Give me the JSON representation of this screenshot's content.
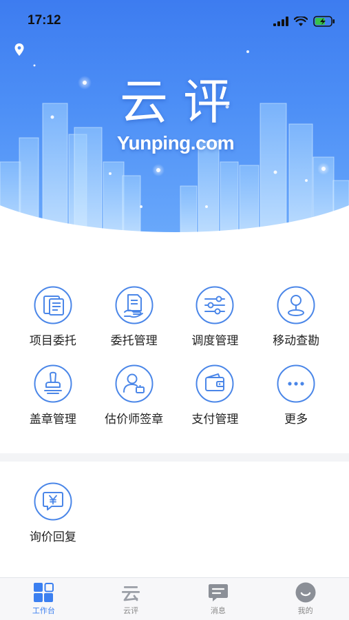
{
  "status_bar": {
    "time": "17:12"
  },
  "hero": {
    "logo_cn": "云评",
    "logo_en": "Yunping.com"
  },
  "grid": {
    "items": [
      {
        "label": "项目委托",
        "icon": "document-list-icon"
      },
      {
        "label": "委托管理",
        "icon": "document-hand-icon"
      },
      {
        "label": "调度管理",
        "icon": "sliders-icon"
      },
      {
        "label": "移动查勘",
        "icon": "map-pin-icon"
      },
      {
        "label": "盖章管理",
        "icon": "stamp-icon"
      },
      {
        "label": "估价师签章",
        "icon": "user-stamp-icon"
      },
      {
        "label": "支付管理",
        "icon": "wallet-icon"
      },
      {
        "label": "更多",
        "icon": "more-dots-icon"
      }
    ]
  },
  "section2": {
    "items": [
      {
        "label": "询价回复",
        "icon": "yen-chat-icon"
      }
    ]
  },
  "tabbar": {
    "tabs": [
      {
        "label": "工作台",
        "icon": "dashboard-grid-icon",
        "active": true
      },
      {
        "label": "云评",
        "icon": "yunping-logo-icon",
        "active": false
      },
      {
        "label": "消息",
        "icon": "message-icon",
        "active": false
      },
      {
        "label": "我的",
        "icon": "profile-icon",
        "active": false
      }
    ]
  },
  "colors": {
    "accent": "#3b7ff0",
    "icon_stroke": "#4a86e8",
    "hero_top": "#3d7cf0",
    "hero_bottom": "#6aa9fb"
  }
}
